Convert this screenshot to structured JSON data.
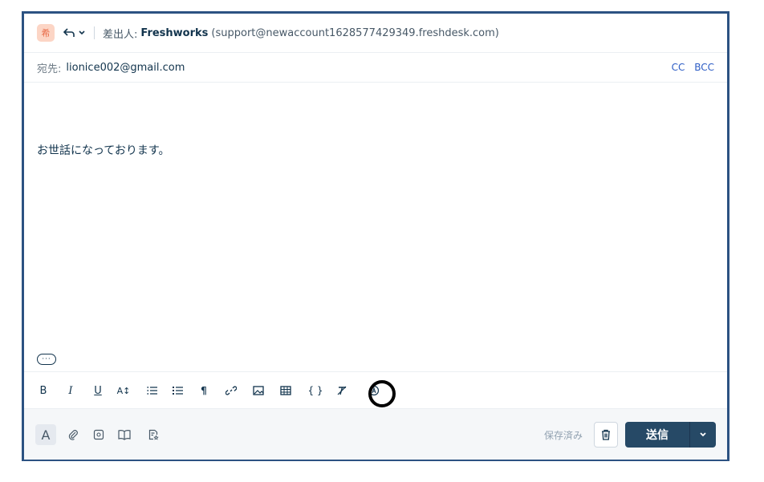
{
  "header": {
    "avatar_text": "希",
    "from_label": "差出人:",
    "from_name": "Freshworks",
    "from_address": "(support@newaccount1628577429349.freshdesk.com)"
  },
  "recipients": {
    "to_label": "宛先:",
    "to_value": "lionice002@gmail.com",
    "cc_label": "CC",
    "bcc_label": "BCC"
  },
  "editor": {
    "body_text": "お世話になっております。",
    "more_label": "···"
  },
  "toolbar": {
    "items": [
      {
        "name": "bold-button",
        "glyph": "B"
      },
      {
        "name": "italic-button",
        "glyph": "I"
      },
      {
        "name": "underline-button",
        "glyph": "U"
      },
      {
        "name": "font-size-button",
        "glyph": "A↕"
      },
      {
        "name": "ordered-list-button",
        "glyph": "≔"
      },
      {
        "name": "unordered-list-button",
        "glyph": "☰"
      },
      {
        "name": "paragraph-button",
        "glyph": "¶"
      },
      {
        "name": "link-button",
        "glyph": "🔗"
      },
      {
        "name": "image-button",
        "glyph": "▣"
      },
      {
        "name": "table-button",
        "glyph": "⊞"
      },
      {
        "name": "code-button",
        "glyph": "{ }"
      },
      {
        "name": "clear-format-button",
        "glyph": "T̸"
      },
      {
        "name": "ai-assist-button",
        "glyph": "Ⓐ"
      }
    ]
  },
  "footer": {
    "saved_text": "保存済み",
    "send_label": "送信"
  },
  "colors": {
    "frame_border": "#2c5282",
    "send_bg": "#264966",
    "link_blue": "#2c5cc5"
  }
}
